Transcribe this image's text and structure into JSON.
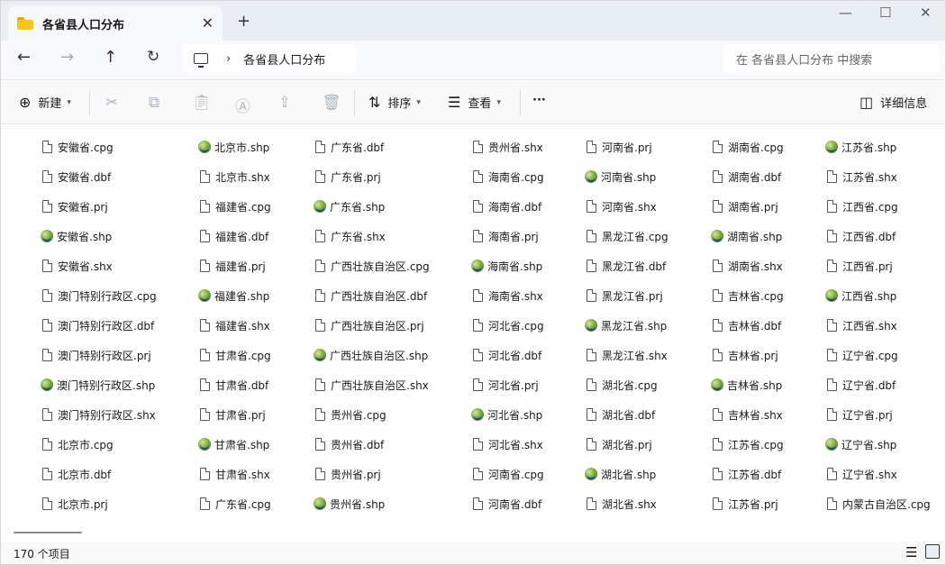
{
  "window": {
    "tab_title": "各省县人口分布",
    "tab_close": "✕",
    "tab_add": "+"
  },
  "controls": {
    "minimize": "—",
    "maximize": "☐",
    "close": "✕"
  },
  "address": {
    "path": "各省县人口分布",
    "separator": "›",
    "search_placeholder": "在 各省县人口分布 中搜索"
  },
  "toolbar": {
    "new_label": "新建",
    "sort_label": "排序",
    "view_label": "查看",
    "more_label": "···",
    "details_label": "详细信息"
  },
  "status": {
    "count": "170 个项目"
  },
  "icons": {
    "doc": "document-icon",
    "shp": "globe-icon"
  },
  "files": [
    [
      "安徽省.cpg",
      "安徽省.dbf",
      "安徽省.prj",
      "安徽省.shp",
      "安徽省.shx",
      "澳门特别行政区.cpg",
      "澳门特别行政区.dbf",
      "澳门特别行政区.prj",
      "澳门特别行政区.shp",
      "澳门特别行政区.shx",
      "北京市.cpg",
      "北京市.dbf",
      "北京市.prj"
    ],
    [
      "北京市.shp",
      "北京市.shx",
      "福建省.cpg",
      "福建省.dbf",
      "福建省.prj",
      "福建省.shp",
      "福建省.shx",
      "甘肃省.cpg",
      "甘肃省.dbf",
      "甘肃省.prj",
      "甘肃省.shp",
      "甘肃省.shx",
      "广东省.cpg"
    ],
    [
      "广东省.dbf",
      "广东省.prj",
      "广东省.shp",
      "广东省.shx",
      "广西壮族自治区.cpg",
      "广西壮族自治区.dbf",
      "广西壮族自治区.prj",
      "广西壮族自治区.shp",
      "广西壮族自治区.shx",
      "贵州省.cpg",
      "贵州省.dbf",
      "贵州省.prj",
      "贵州省.shp"
    ],
    [
      "贵州省.shx",
      "海南省.cpg",
      "海南省.dbf",
      "海南省.prj",
      "海南省.shp",
      "海南省.shx",
      "河北省.cpg",
      "河北省.dbf",
      "河北省.prj",
      "河北省.shp",
      "河北省.shx",
      "河南省.cpg",
      "河南省.dbf"
    ],
    [
      "河南省.prj",
      "河南省.shp",
      "河南省.shx",
      "黑龙江省.cpg",
      "黑龙江省.dbf",
      "黑龙江省.prj",
      "黑龙江省.shp",
      "黑龙江省.shx",
      "湖北省.cpg",
      "湖北省.dbf",
      "湖北省.prj",
      "湖北省.shp",
      "湖北省.shx"
    ],
    [
      "湖南省.cpg",
      "湖南省.dbf",
      "湖南省.prj",
      "湖南省.shp",
      "湖南省.shx",
      "吉林省.cpg",
      "吉林省.dbf",
      "吉林省.prj",
      "吉林省.shp",
      "吉林省.shx",
      "江苏省.cpg",
      "江苏省.dbf",
      "江苏省.prj"
    ],
    [
      "江苏省.shp",
      "江苏省.shx",
      "江西省.cpg",
      "江西省.dbf",
      "江西省.prj",
      "江西省.shp",
      "江西省.shx",
      "辽宁省.cpg",
      "辽宁省.dbf",
      "辽宁省.prj",
      "辽宁省.shp",
      "辽宁省.shx",
      "内蒙古自治区.cpg"
    ]
  ]
}
